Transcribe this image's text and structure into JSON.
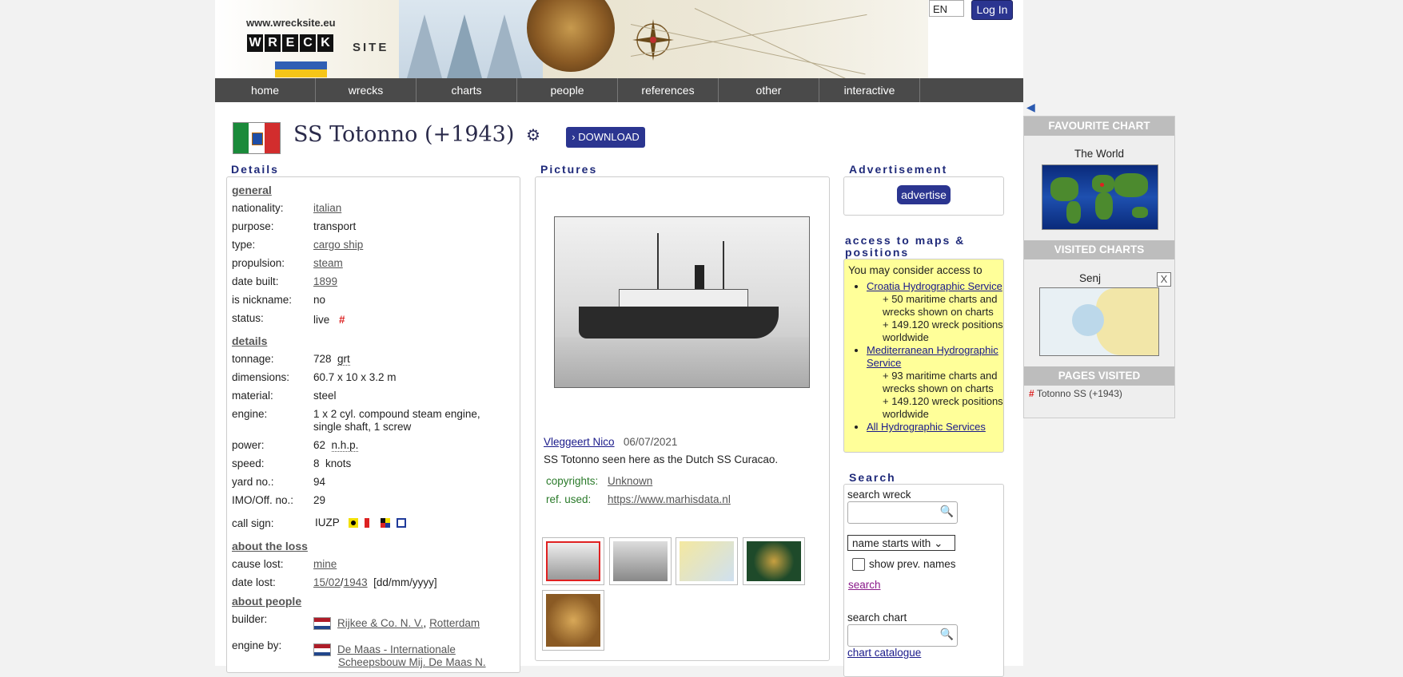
{
  "header": {
    "site_url": "www.wrecksite.eu",
    "logo_letters": [
      "W",
      "R",
      "E",
      "C",
      "K"
    ],
    "logo_site": "SITE",
    "language": "EN",
    "login_label": "Log In",
    "colors": {
      "ua_blue": "#2f5fb4",
      "ua_yellow": "#f5c518",
      "brand": "#2b3590"
    }
  },
  "nav": [
    "home",
    "wrecks",
    "charts",
    "people",
    "references",
    "other",
    "interactive"
  ],
  "wreck": {
    "title": "SS Totonno (+1943)",
    "download_label": "DOWNLOAD",
    "flag_colors": [
      "#1a8a3a",
      "#ffffff",
      "#d22d2d"
    ]
  },
  "details": {
    "heading": "Details",
    "general_label": "general",
    "nationality": {
      "label": "nationality:",
      "value": "italian"
    },
    "purpose": {
      "label": "purpose:",
      "value": "transport"
    },
    "type": {
      "label": "type:",
      "value": "cargo ship"
    },
    "propulsion": {
      "label": "propulsion:",
      "value": "steam"
    },
    "date_built": {
      "label": "date built:",
      "value": "1899"
    },
    "is_nickname": {
      "label": "is nickname:",
      "value": "no"
    },
    "status": {
      "label": "status:",
      "value": "live"
    },
    "details_label": "details",
    "tonnage": {
      "label": "tonnage:",
      "value": "728",
      "unit": "grt"
    },
    "dimensions": {
      "label": "dimensions:",
      "value": "60.7 x 10 x 3.2 m"
    },
    "material": {
      "label": "material:",
      "value": "steel"
    },
    "engine": {
      "label": "engine:",
      "value_line1": "1 x 2 cyl. compound steam engine,",
      "value_line2": "single shaft, 1 screw"
    },
    "power": {
      "label": "power:",
      "value": "62",
      "unit": "n.h.p."
    },
    "speed": {
      "label": "speed:",
      "value": "8",
      "unit": "knots"
    },
    "yard_no": {
      "label": "yard no.:",
      "value": "94"
    },
    "imo": {
      "label": "IMO/Off. no.:",
      "value": "29"
    },
    "call_sign": {
      "label": "call sign:",
      "value": "IUZP"
    },
    "loss_label": "about the loss",
    "cause_lost": {
      "label": "cause lost:",
      "value": "mine"
    },
    "date_lost": {
      "label": "date lost:",
      "day_month": "15/02",
      "year": "1943",
      "format": "[dd/mm/yyyy]"
    },
    "people_label": "about people",
    "builder": {
      "label": "builder:",
      "name": "Rijkee & Co. N. V.",
      "place": "Rotterdam"
    },
    "engine_by": {
      "label": "engine by:",
      "line1": "De Maas - Internationale",
      "line2": "Scheepsbouw Mij. De Maas N."
    }
  },
  "pictures": {
    "heading": "Pictures",
    "author": "Vleggeert Nico",
    "date": "06/07/2021",
    "caption": "SS Totonno seen here as the Dutch SS Curacao.",
    "copyrights_label": "copyrights:",
    "copyrights_value": "Unknown",
    "ref_label": "ref. used:",
    "ref_value": "https://www.marhisdata.nl"
  },
  "advertisement": {
    "heading": "Advertisement",
    "button": "advertise"
  },
  "access": {
    "heading_line1": "access to maps &",
    "heading_line2": "positions",
    "intro": "You may consider access to",
    "items": [
      {
        "link": "Croatia Hydrographic Service",
        "line1": "+ 50 maritime charts and wrecks shown on charts",
        "line2": "+ 149.120 wreck positions worldwide"
      },
      {
        "link": "Mediterranean Hydrographic Service",
        "line1": "+ 93 maritime charts and wrecks shown on charts",
        "line2": "+ 149.120 wreck positions worldwide"
      },
      {
        "link": "All Hydrographic Services"
      }
    ]
  },
  "search": {
    "heading": "Search",
    "wreck_label": "search wreck",
    "wreck_placeholder": "",
    "mode": "name starts with",
    "prev_names": "show prev. names",
    "search_link": "search",
    "chart_label": "search chart",
    "chart_catalogue": "chart catalogue"
  },
  "sidebar": {
    "favourite_heading": "FAVOURITE CHART",
    "favourite_name": "The World",
    "visited_heading": "VISITED CHARTS",
    "visited_name": "Senj",
    "close": "X",
    "pages_heading": "PAGES VISITED",
    "page_item": "Totonno SS (+1943)"
  }
}
